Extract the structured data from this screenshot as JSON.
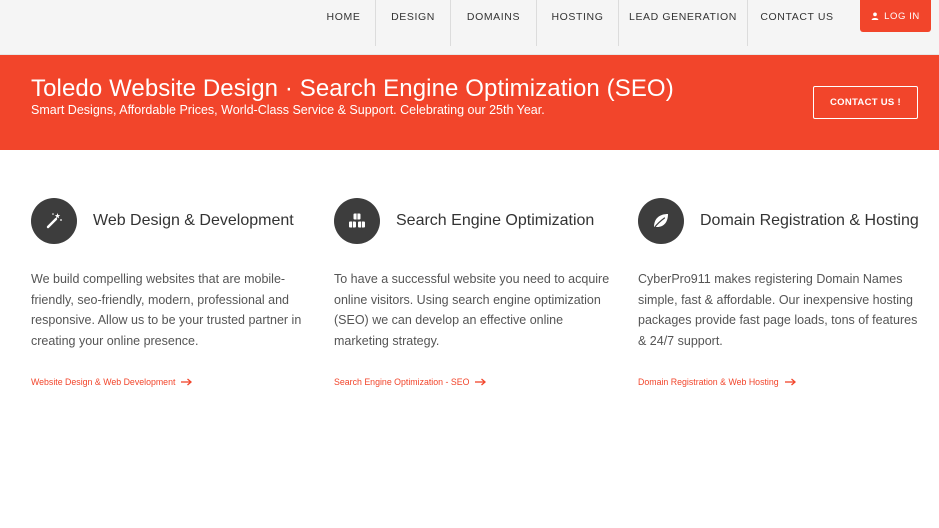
{
  "nav": {
    "items": [
      {
        "label": "HOME"
      },
      {
        "label": "DESIGN"
      },
      {
        "label": "DOMAINS"
      },
      {
        "label": "HOSTING"
      },
      {
        "label": "LEAD GENERATION"
      },
      {
        "label": "CONTACT US"
      }
    ],
    "login_label": "LOG IN"
  },
  "hero": {
    "title": "Toledo Website Design · Search Engine Optimization (SEO)",
    "subtitle": "Smart Designs, Affordable Prices, World-Class Service & Support. Celebrating our 25th Year.",
    "contact_label": "CONTACT US !"
  },
  "features": [
    {
      "icon": "magic-wand-icon",
      "title": "Web Design & Development",
      "text": "We build compelling websites that are mobile-friendly, seo-friendly, modern, professional and responsive. Allow us to be your trusted partner in creating your online presence.",
      "link": "Website Design & Web Development"
    },
    {
      "icon": "cubes-icon",
      "title": "Search Engine Optimization",
      "text": "To have a successful website you need to acquire online visitors. Using search engine optimization (SEO) we can develop an effective online marketing strategy.",
      "link": "Search Engine Optimization - SEO"
    },
    {
      "icon": "leaf-icon",
      "title": "Domain Registration & Hosting",
      "text": "CyberPro911 makes registering Domain Names simple, fast & affordable. Our inexpensive hosting packages provide fast page loads, tons of features & 24/7 support.",
      "link": "Domain Registration & Web Hosting"
    }
  ],
  "colors": {
    "accent": "#f2452b",
    "icon_bg": "#3d3d3d",
    "topbar_bg": "#f5f5f5"
  }
}
